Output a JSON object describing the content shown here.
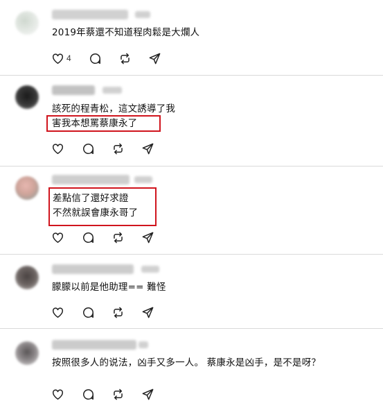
{
  "feed": {
    "posts": [
      {
        "text_lines": [
          "2019年蔡還不知道程肉鬆是大爛人"
        ],
        "like_count": "4",
        "icons": [
          "heart-icon",
          "comment-icon",
          "repost-icon",
          "share-icon"
        ]
      },
      {
        "text_lines": [
          "該死的程青松，這文誘導了我",
          "害我本想罵蔡康永了"
        ],
        "like_count": "",
        "icons": [
          "heart-icon",
          "comment-icon",
          "repost-icon",
          "share-icon"
        ]
      },
      {
        "text_lines": [
          "差點信了還好求證",
          "不然就誤會康永哥了"
        ],
        "like_count": "",
        "icons": [
          "heart-icon",
          "comment-icon",
          "repost-icon",
          "share-icon"
        ]
      },
      {
        "text_lines": [
          "朦朦以前是他助理== 難怪"
        ],
        "like_count": "",
        "icons": [
          "heart-icon",
          "comment-icon",
          "repost-icon",
          "share-icon"
        ]
      },
      {
        "text_lines": [
          "按照很多人的说法，凶手又多一人。 蔡康永是凶手，是不是呀？"
        ],
        "like_count": "",
        "icons": [
          "heart-icon",
          "comment-icon",
          "repost-icon",
          "share-icon"
        ]
      }
    ]
  },
  "colors": {
    "highlight_box": "#d0141d",
    "separator": "#d9d9d9",
    "text": "#101010"
  }
}
